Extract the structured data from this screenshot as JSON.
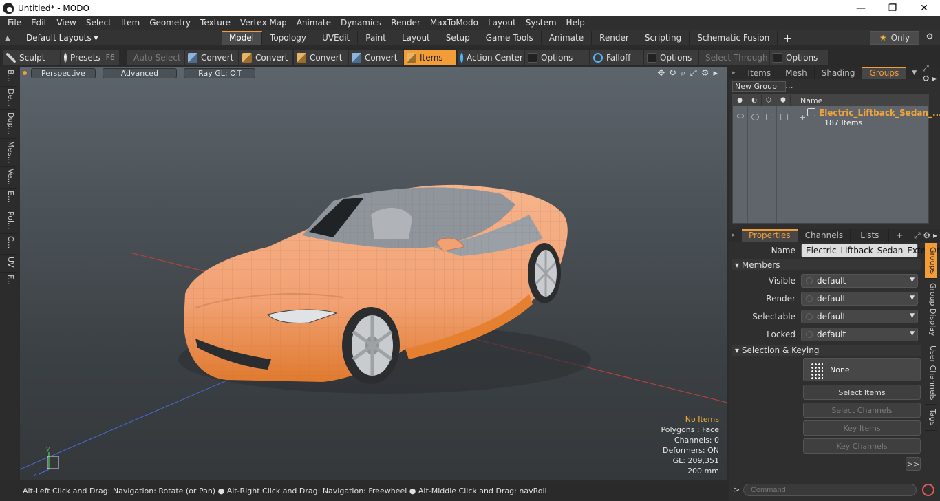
{
  "window": {
    "title": "Untitled* - MODO",
    "minimize": "—",
    "maximize": "❐",
    "close": "✕"
  },
  "menu": [
    "File",
    "Edit",
    "View",
    "Select",
    "Item",
    "Geometry",
    "Texture",
    "Vertex Map",
    "Animate",
    "Dynamics",
    "Render",
    "MaxToModo",
    "Layout",
    "System",
    "Help"
  ],
  "layoutbar": {
    "default_layouts": "Default Layouts ▾",
    "tabs": [
      "Model",
      "Topology",
      "UVEdit",
      "Paint",
      "Layout",
      "Setup",
      "Game Tools",
      "Animate",
      "Render",
      "Scripting",
      "Schematic Fusion"
    ],
    "active_tab": "Model",
    "only_label": "Only",
    "plus": "+"
  },
  "toolbar": {
    "sculpt": "Sculpt",
    "presets": "Presets",
    "presets_key": "F6",
    "auto_select": "Auto Select",
    "convert1": "Convert",
    "convert2": "Convert",
    "convert3": "Convert",
    "convert4": "Convert",
    "items": "Items",
    "action_center": "Action Center",
    "options1": "Options",
    "falloff": "Falloff",
    "options2": "Options",
    "select_through": "Select Through",
    "options3": "Options"
  },
  "left_tabs": [
    "B...",
    "De...",
    "Dup...",
    "Mes...",
    "Ve...",
    "E...",
    "Pol...",
    "C...",
    "UV",
    "F..."
  ],
  "viewport": {
    "perspective": "Perspective",
    "advanced": "Advanced",
    "raygl": "Ray GL: Off",
    "info": {
      "no_items": "No Items",
      "polygons": "Polygons : Face",
      "channels": "Channels: 0",
      "deformers": "Deformers: ON",
      "gl": "GL: 209,351",
      "scale": "200 mm"
    }
  },
  "status": "Alt-Left Click and Drag: Navigation: Rotate (or Pan) ● Alt-Right Click and Drag: Navigation: Freewheel ● Alt-Middle Click and Drag: navRoll",
  "groups_panel": {
    "tabs": [
      "Items",
      "Mesh ...",
      "Shading",
      "Groups"
    ],
    "active_tab": "Groups",
    "new_group": "New Group",
    "col_name": "Name",
    "group_name": "Electric_Liftback_Sedan_...",
    "group_count": "187 Items"
  },
  "properties": {
    "tabs": [
      "Properties",
      "Channels",
      "Lists"
    ],
    "plus": "+",
    "name_label": "Name",
    "name_value": "Electric_Liftback_Sedan_Exterior",
    "members_section": "Members",
    "visible_label": "Visible",
    "visible_value": "default",
    "render_label": "Render",
    "render_value": "default",
    "selectable_label": "Selectable",
    "selectable_value": "default",
    "locked_label": "Locked",
    "locked_value": "default",
    "selection_section": "Selection & Keying",
    "none_label": "None",
    "select_items": "Select Items",
    "select_channels": "Select Channels",
    "key_items": "Key Items",
    "key_channels": "Key Channels",
    "expand": ">>",
    "vtabs": [
      "Groups",
      "Group Display",
      "User Channels",
      "Tags"
    ],
    "command_placeholder": "Command",
    "prompt": ">"
  },
  "colors": {
    "accent": "#f29d38",
    "car_body": "#f3a77a",
    "group_name": "#f2a53a"
  }
}
